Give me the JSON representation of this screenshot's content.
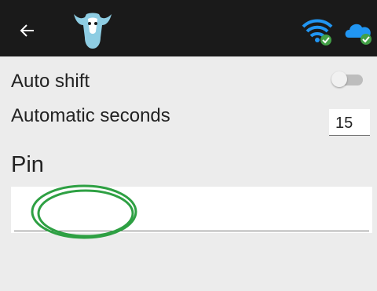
{
  "header": {
    "back_icon": "arrow-left-icon",
    "logo_icon": "cow-head-logo",
    "wifi_icon": "wifi-connected-icon",
    "cloud_icon": "cloud-synced-icon",
    "colors": {
      "background": "#1a1a1a",
      "accent": "#2196f3",
      "ok": "#43a047",
      "logo": "#7fc8e0"
    }
  },
  "settings": {
    "auto_shift": {
      "label": "Auto shift",
      "enabled": false
    },
    "automatic_seconds": {
      "label": "Automatic seconds",
      "value": "15"
    }
  },
  "pin": {
    "label": "Pin",
    "value": "",
    "annotation_color": "#2ea043"
  }
}
